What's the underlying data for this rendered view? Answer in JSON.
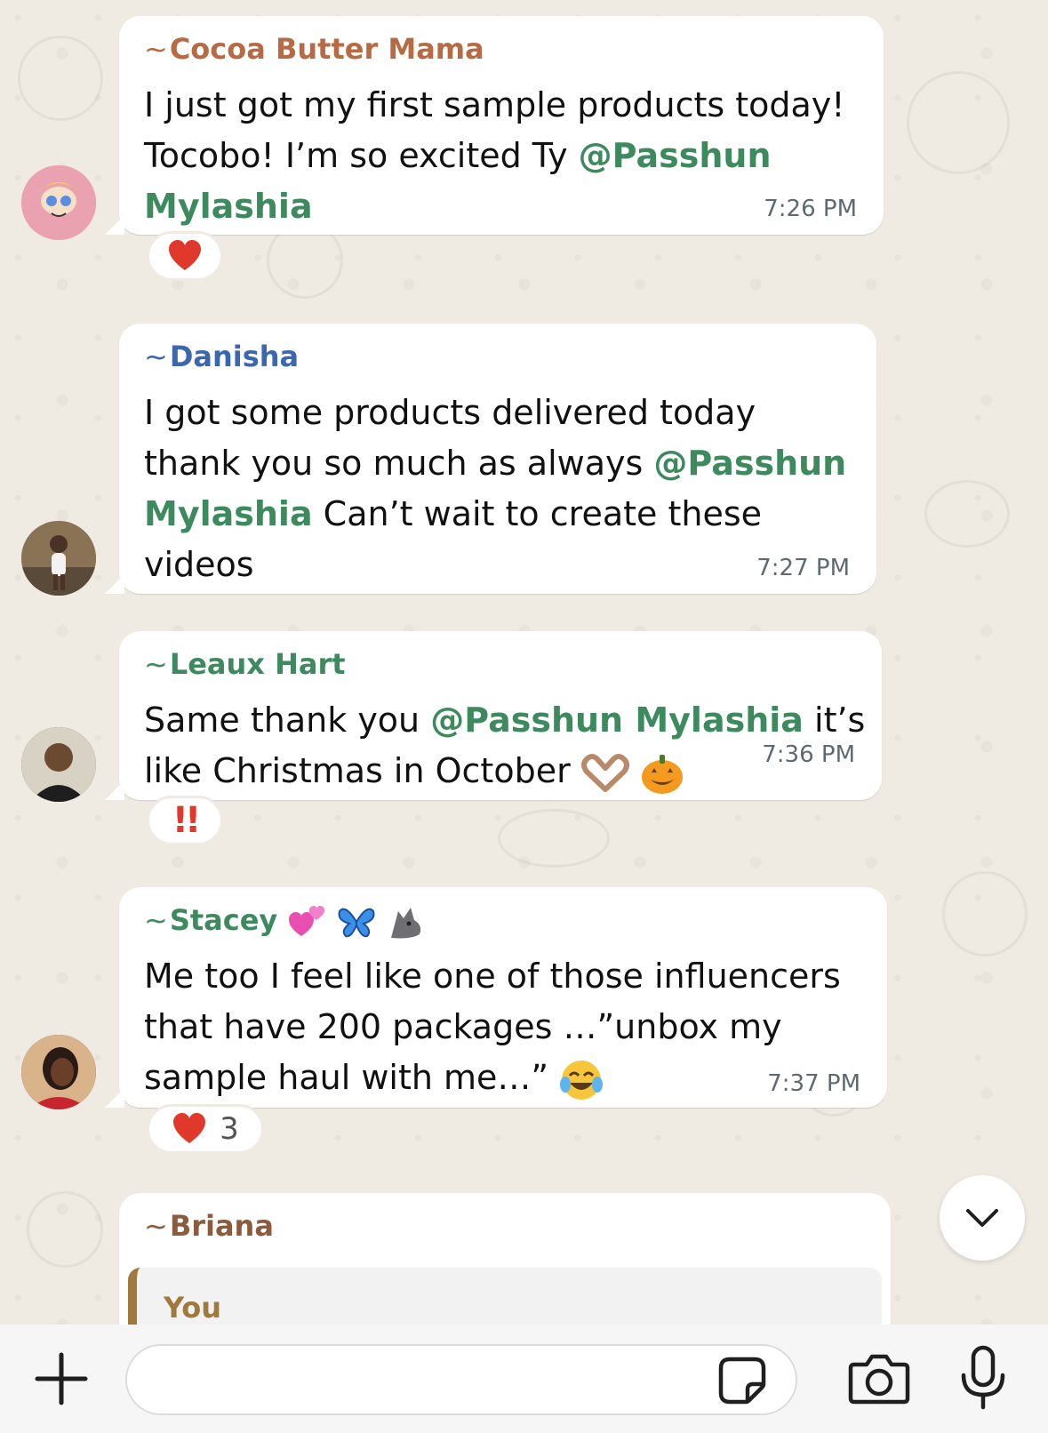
{
  "colors": {
    "chat_background": "#efeae2",
    "bubble": "#ffffff",
    "mention": "#3e8a5f",
    "timestamp": "#5e6a70",
    "heart": "#e0392b"
  },
  "messages": [
    {
      "sender": "Cocoa Butter Mama",
      "sender_color": "#b76b44",
      "text_parts": [
        "I just got my first sample products today!",
        "Tocobo! I’m so excited Ty ",
        "@Passhun",
        "Mylashia"
      ],
      "time": "7:26 PM",
      "reaction": {
        "icon": "heart-icon",
        "count": ""
      }
    },
    {
      "sender": "Danisha",
      "sender_color": "#3b67b0",
      "text_parts": [
        "I got some products delivered today",
        "thank you so much as always ",
        "@Passhun",
        "Mylashia",
        " Can’t wait to create these",
        "videos"
      ],
      "time": "7:27 PM"
    },
    {
      "sender": "Leaux Hart",
      "sender_color": "#3e8a5f",
      "text_parts": [
        "Same thank you ",
        "@Passhun Mylashia",
        " it’s",
        "like Christmas in October"
      ],
      "emojis": [
        "heart-hands-emoji",
        "jack-o-lantern-emoji"
      ],
      "time": "7:36 PM",
      "reaction": {
        "icon": "double-exclamation-icon",
        "count": ""
      }
    },
    {
      "sender": "Stacey",
      "sender_emojis": [
        "two-hearts-emoji",
        "butterfly-emoji",
        "wolf-emoji"
      ],
      "sender_color": "#3e8a5f",
      "text_parts": [
        "Me too I feel like one of those influencers",
        "that have 200 packages …”unbox my",
        "sample haul with me…”"
      ],
      "emojis": [
        "tears-of-joy-emoji"
      ],
      "time": "7:37 PM",
      "reaction": {
        "icon": "heart-icon",
        "count": "3"
      }
    },
    {
      "sender": "Briana",
      "sender_color": "#8a5b3c",
      "quoted_name": "You"
    }
  ],
  "composer": {
    "placeholder": "",
    "icons": [
      "plus-icon",
      "sticker-icon",
      "camera-icon",
      "microphone-icon"
    ]
  },
  "scroll_button_icon": "chevron-down-icon"
}
